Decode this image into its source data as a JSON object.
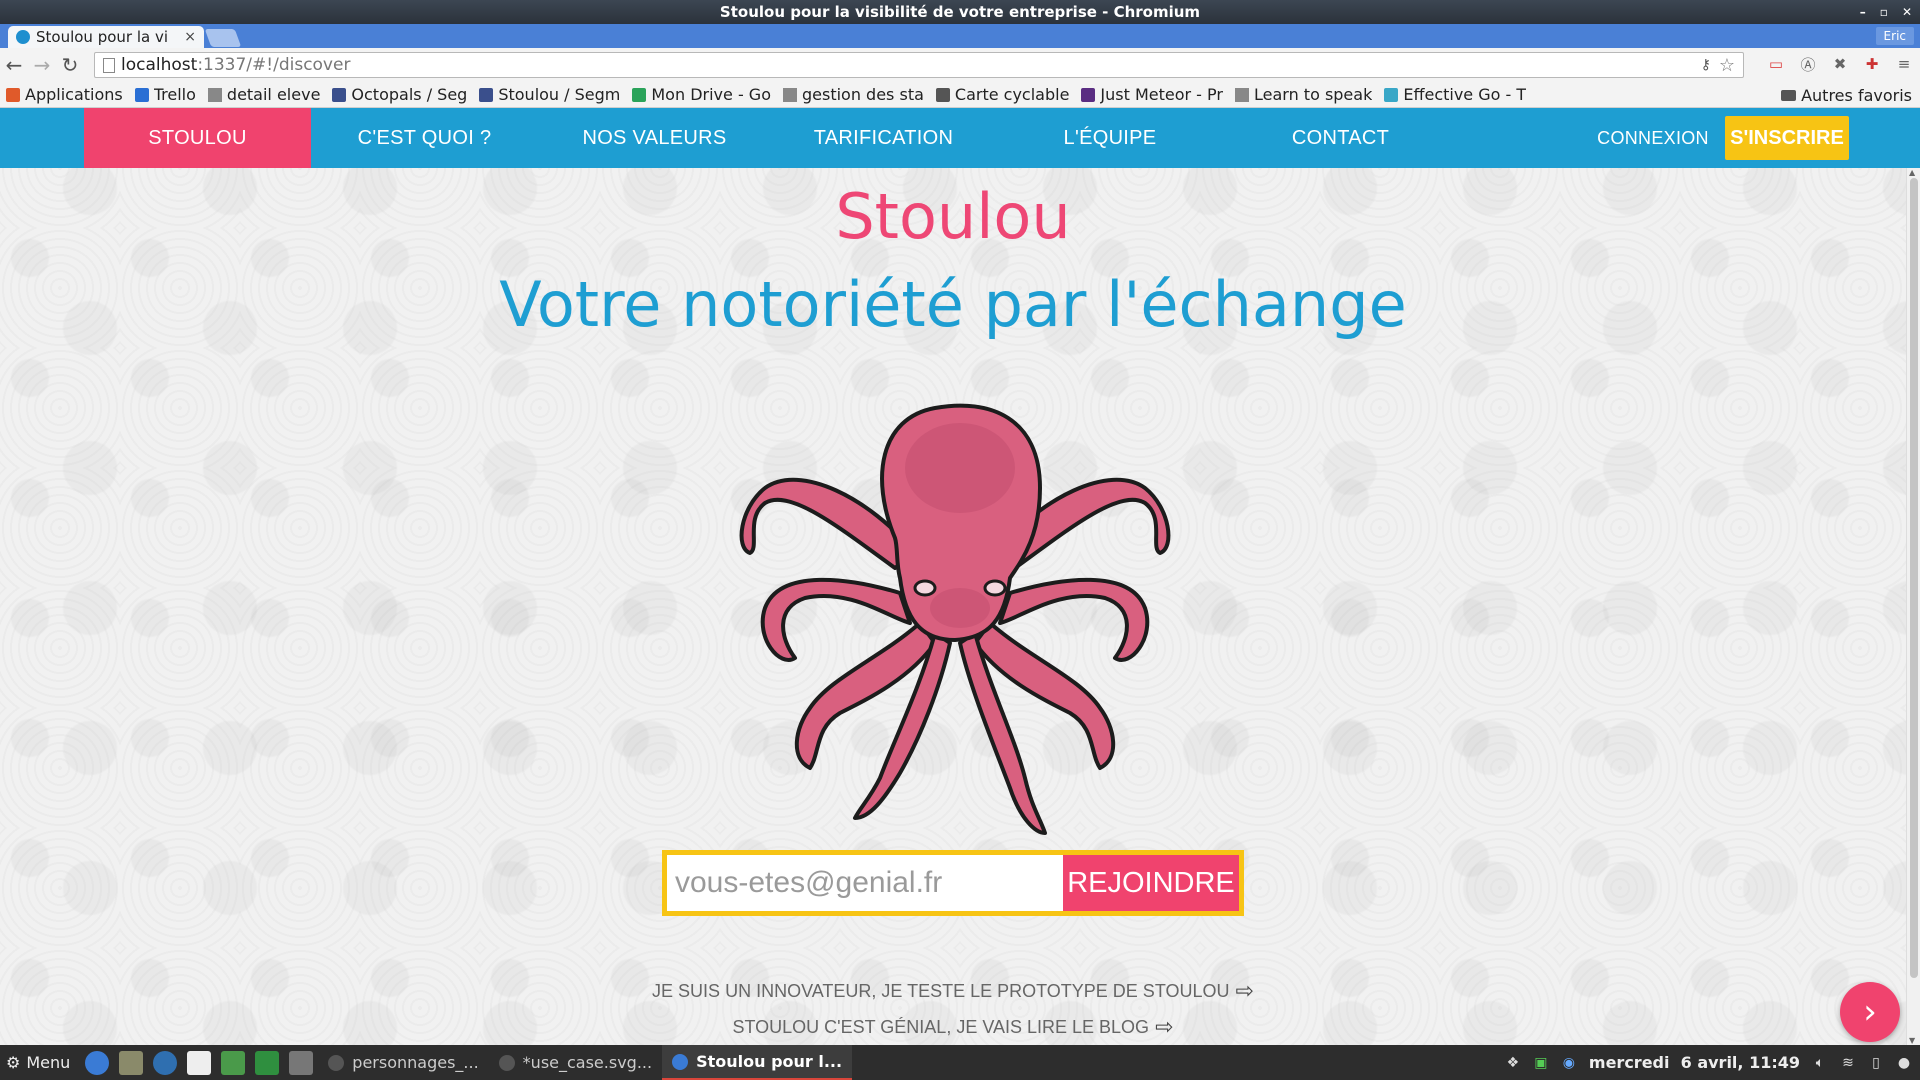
{
  "window": {
    "title": "Stoulou pour la visibilité de votre entreprise - Chromium",
    "profile": "Eric"
  },
  "tab": {
    "title": "Stoulou pour la vi",
    "close": "×"
  },
  "toolbar": {
    "url_host": "localhost",
    "url_rest": ":1337/#!/discover"
  },
  "bookmarks": {
    "items": [
      {
        "label": "Applications",
        "icon": "apps-grid-icon",
        "color": "#e05a2a"
      },
      {
        "label": "Trello",
        "icon": "trello-icon",
        "color": "#2a6fd4"
      },
      {
        "label": "detail eleve",
        "icon": "page-icon",
        "color": "#888888"
      },
      {
        "label": "Octopals / Seg",
        "icon": "segment-icon",
        "color": "#3a4f8c"
      },
      {
        "label": "Stoulou / Segm",
        "icon": "segment-icon",
        "color": "#3a4f8c"
      },
      {
        "label": "Mon Drive - Go",
        "icon": "drive-icon",
        "color": "#2aa35a"
      },
      {
        "label": "gestion des sta",
        "icon": "page-icon",
        "color": "#888888"
      },
      {
        "label": "Carte cyclable",
        "icon": "bike-icon",
        "color": "#555555"
      },
      {
        "label": "Just Meteor - Pr",
        "icon": "meteor-icon",
        "color": "#5a2d82"
      },
      {
        "label": "Learn to speak",
        "icon": "page-icon",
        "color": "#888888"
      },
      {
        "label": "Effective Go - T",
        "icon": "go-icon",
        "color": "#39a7c7"
      }
    ],
    "other": "Autres favoris"
  },
  "site": {
    "nav": {
      "brand": "STOULOU",
      "items": [
        "C'EST QUOI ?",
        "NOS VALEURS",
        "TARIFICATION",
        "L'ÉQUIPE",
        "CONTACT"
      ],
      "login": "CONNEXION",
      "signup": "S'INSCRIRE"
    },
    "hero": {
      "title": "Stoulou",
      "subtitle": "Votre notoriété par l'échange"
    },
    "form": {
      "placeholder": "vous-etes@genial.fr",
      "button": "REJOINDRE"
    },
    "links": {
      "prototype": "JE SUIS UN INNOVATEUR, JE TESTE LE PROTOTYPE DE STOULOU",
      "blog": "STOULOU C'EST GÉNIAL, JE VAIS LIRE LE BLOG"
    },
    "colors": {
      "primary_blue": "#1e9ed2",
      "brand_pink": "#f0436e",
      "accent_yellow": "#f7c414"
    }
  },
  "taskbar": {
    "menu": "Menu",
    "tasks": [
      {
        "label": "personnages_...",
        "active": false
      },
      {
        "label": "*use_case.svg...",
        "active": false
      },
      {
        "label": "Stoulou pour l...",
        "active": true
      }
    ],
    "clock": "mercredi  6 avril, 11:49"
  }
}
